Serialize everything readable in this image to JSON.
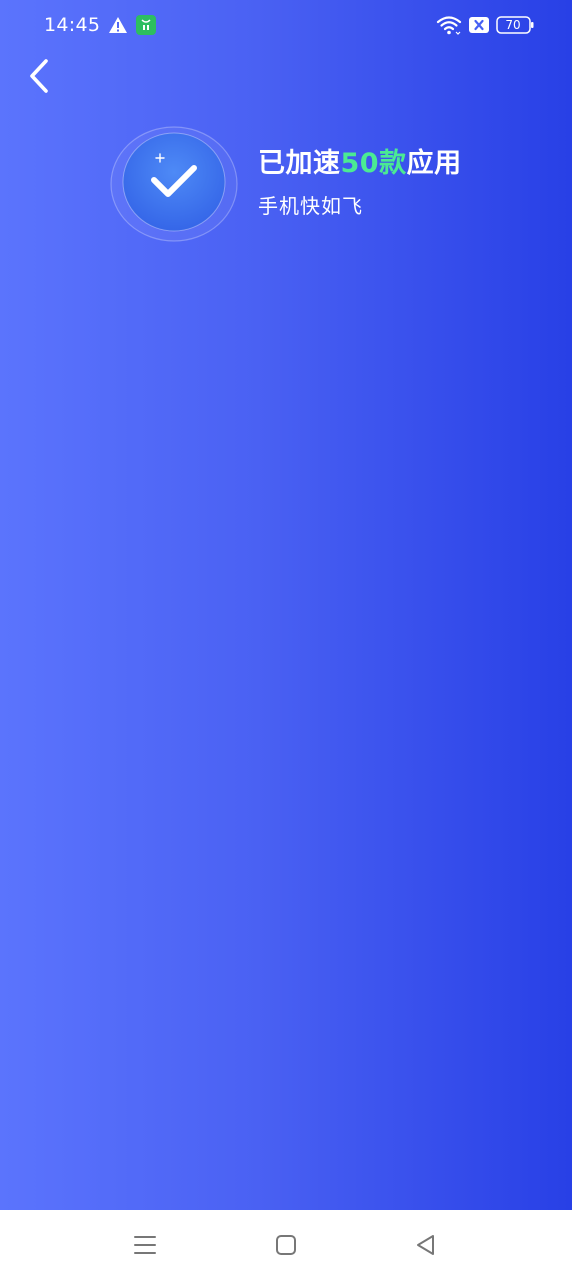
{
  "status_bar": {
    "time": "14:45",
    "battery_level": "70",
    "icons": [
      "warning-icon",
      "app-notification-icon",
      "wifi-icon",
      "sim-off-icon",
      "battery-icon"
    ]
  },
  "toolbar": {
    "back_icon": "chevron-left-icon"
  },
  "result": {
    "icon": "check-icon",
    "title_prefix": "已加速",
    "count": "50款",
    "title_suffix": "应用",
    "subtitle": "手机快如飞"
  },
  "colors": {
    "gradient_start": "#5B74FD",
    "gradient_end": "#2840E6",
    "accent_green": "#4BEA93",
    "text": "#FFFFFF",
    "nav_bar_bg": "#FFFFFF",
    "nav_icon": "#777777"
  },
  "nav_bar": {
    "icons": [
      "menu-icon",
      "home-icon",
      "back-triangle-icon"
    ]
  }
}
